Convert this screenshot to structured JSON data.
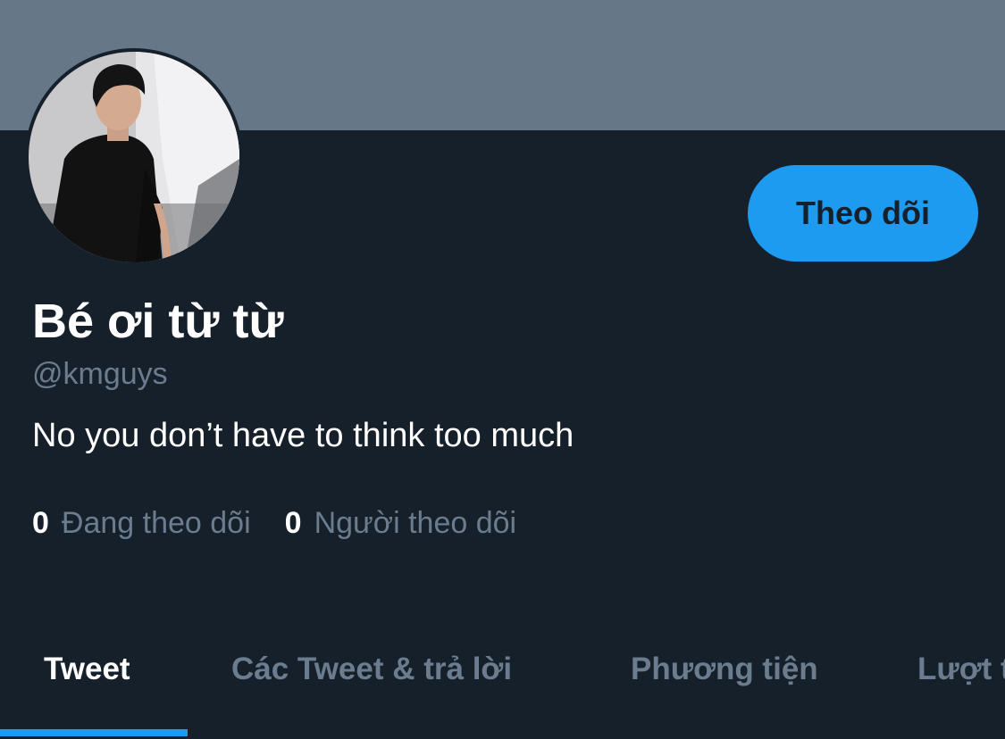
{
  "profile": {
    "display_name": "Bé ơi từ từ",
    "handle": "@kmguys",
    "bio": "No you don’t have to think too much",
    "follow_label": "Theo dõi"
  },
  "stats": {
    "following_count": "0",
    "following_label": "Đang theo dõi",
    "followers_count": "0",
    "followers_label": "Người theo dõi"
  },
  "tabs": [
    {
      "label": "Tweet",
      "active": true
    },
    {
      "label": "Các Tweet & trả lời",
      "active": false
    },
    {
      "label": "Phương tiện",
      "active": false
    },
    {
      "label": "Lượt thích",
      "active": false
    }
  ],
  "colors": {
    "background": "#16202b",
    "banner": "#667788",
    "accent": "#1d9bf0",
    "muted_text": "#6a7c8e"
  }
}
